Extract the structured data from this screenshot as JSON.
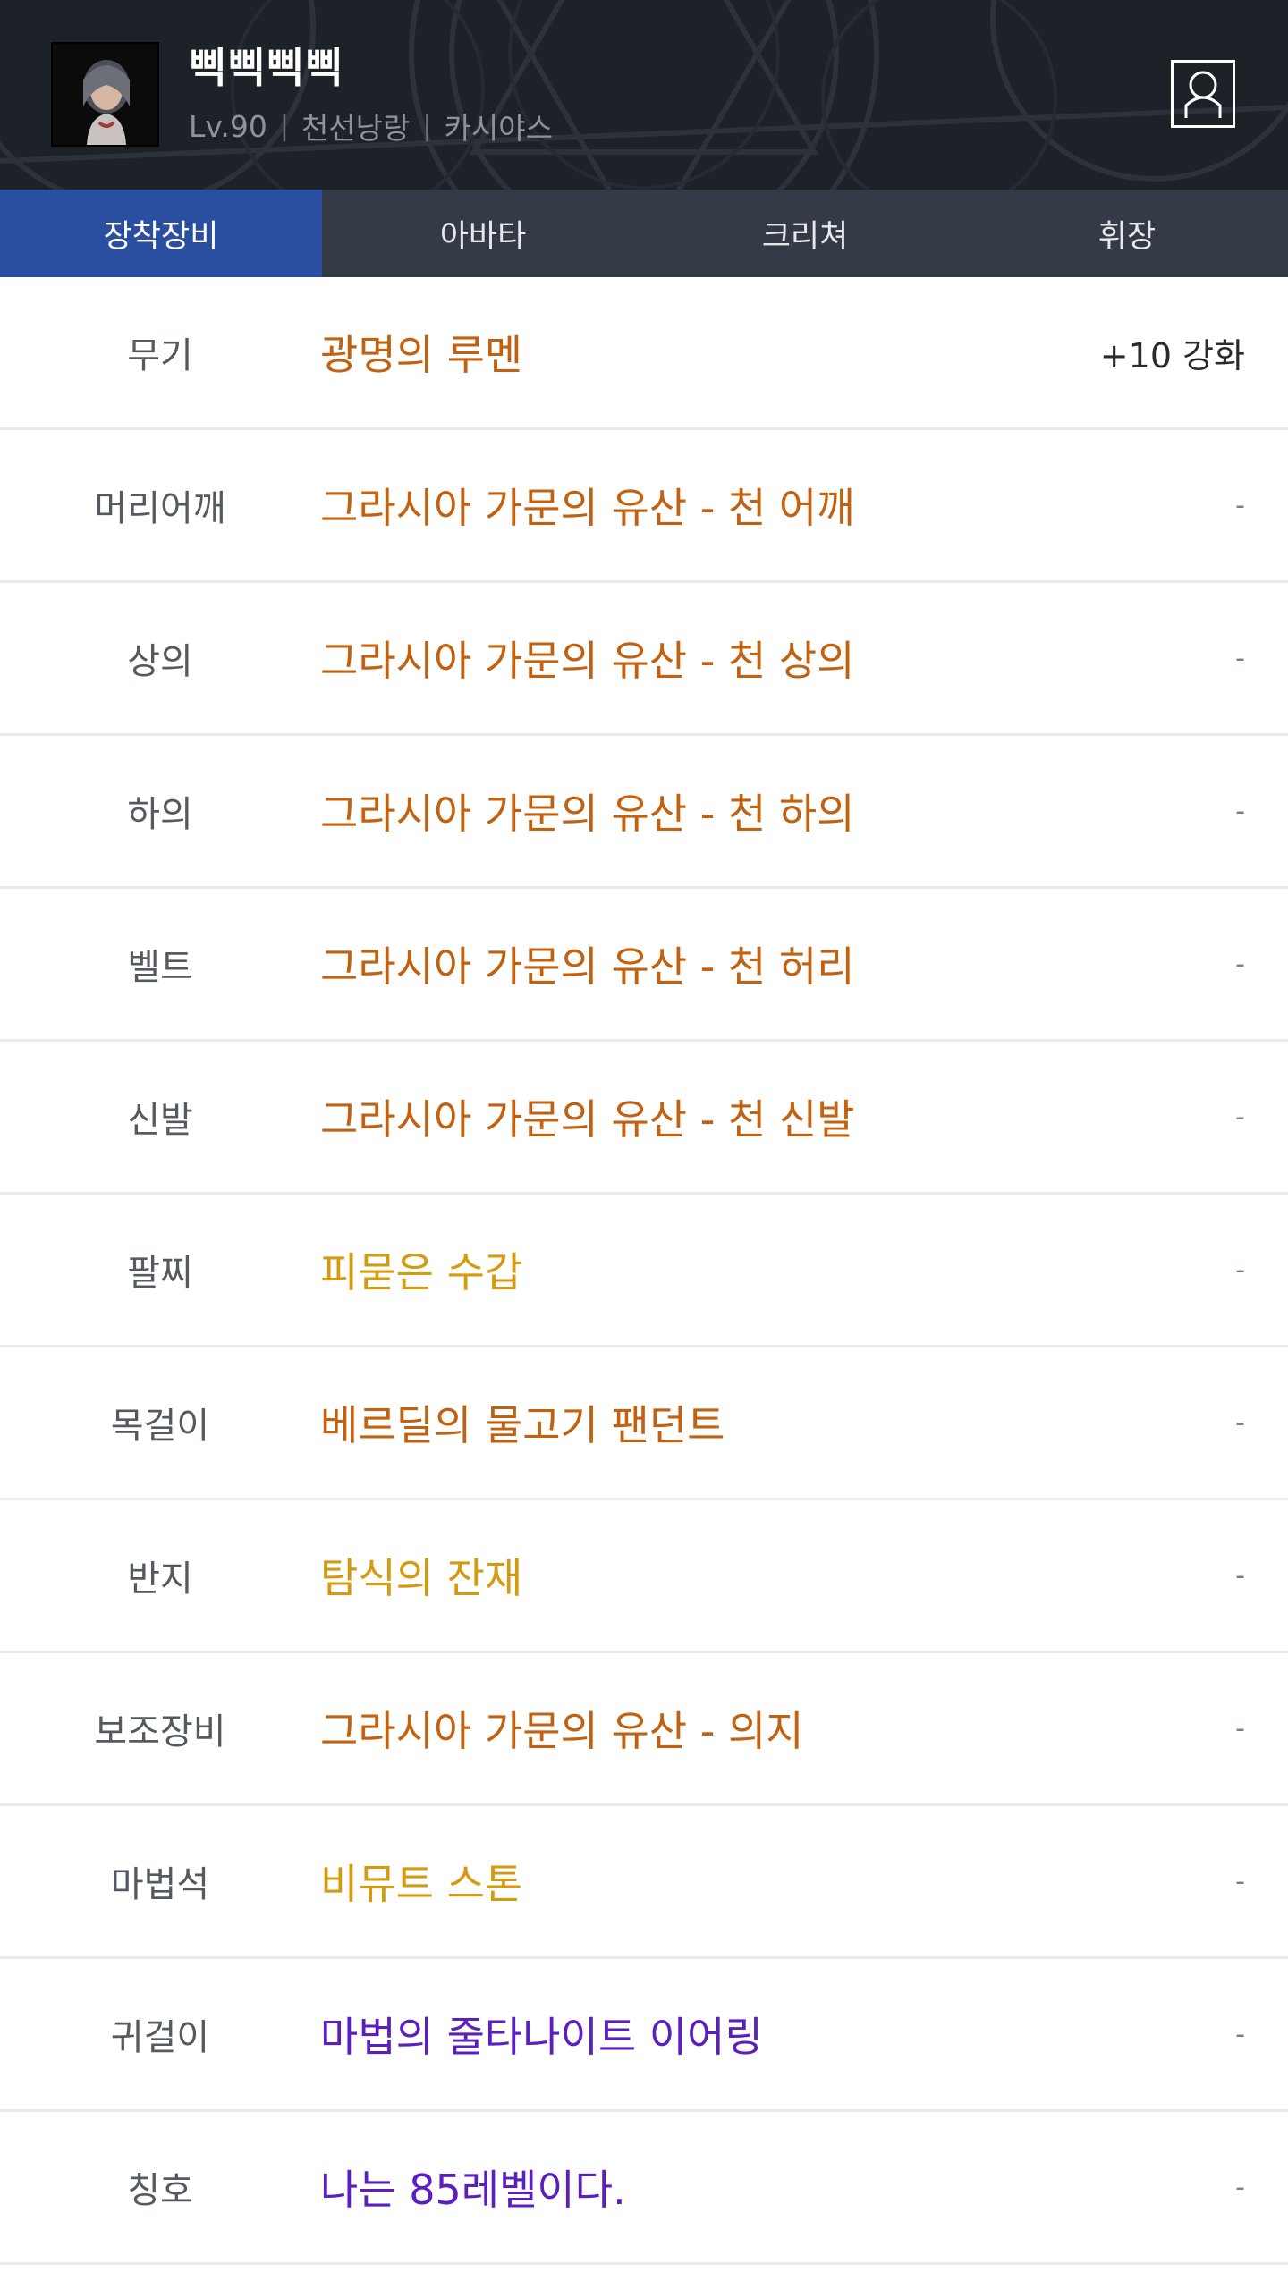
{
  "header": {
    "character_name": "삑삑삑삑",
    "level": "Lv.90",
    "job": "천선낭랑",
    "server": "카시야스",
    "separator": "|",
    "profile_icon": "person-icon"
  },
  "tabs": [
    {
      "label": "장착장비",
      "active": true
    },
    {
      "label": "아바타",
      "active": false
    },
    {
      "label": "크리쳐",
      "active": false
    },
    {
      "label": "휘장",
      "active": false
    }
  ],
  "colors": {
    "unique": "#c2610f",
    "rare_gold": "#d49a10",
    "rare_purple": "#5c1fbf",
    "tab_active": "#2b4fa0"
  },
  "equipment": [
    {
      "slot": "무기",
      "item": "광명의 루멘",
      "extra": "+10 강화",
      "color": "#c2610f"
    },
    {
      "slot": "머리어깨",
      "item": "그라시아 가문의 유산 - 천 어깨",
      "extra": "-",
      "color": "#c2610f"
    },
    {
      "slot": "상의",
      "item": "그라시아 가문의 유산 - 천 상의",
      "extra": "-",
      "color": "#c2610f"
    },
    {
      "slot": "하의",
      "item": "그라시아 가문의 유산 - 천 하의",
      "extra": "-",
      "color": "#c2610f"
    },
    {
      "slot": "벨트",
      "item": "그라시아 가문의 유산 - 천 허리",
      "extra": "-",
      "color": "#c2610f"
    },
    {
      "slot": "신발",
      "item": "그라시아 가문의 유산 - 천 신발",
      "extra": "-",
      "color": "#c2610f"
    },
    {
      "slot": "팔찌",
      "item": "피묻은 수갑",
      "extra": "-",
      "color": "#d49a10"
    },
    {
      "slot": "목걸이",
      "item": "베르딜의 물고기 팬던트",
      "extra": "-",
      "color": "#c2610f"
    },
    {
      "slot": "반지",
      "item": "탐식의 잔재",
      "extra": "-",
      "color": "#d49a10"
    },
    {
      "slot": "보조장비",
      "item": "그라시아 가문의 유산 - 의지",
      "extra": "-",
      "color": "#c2610f"
    },
    {
      "slot": "마법석",
      "item": "비뮤트 스톤",
      "extra": "-",
      "color": "#d49a10"
    },
    {
      "slot": "귀걸이",
      "item": "마법의 줄타나이트 이어링",
      "extra": "-",
      "color": "#5c1fbf"
    },
    {
      "slot": "칭호",
      "item": "나는 85레벨이다.",
      "extra": "-",
      "color": "#5c1fbf"
    }
  ]
}
